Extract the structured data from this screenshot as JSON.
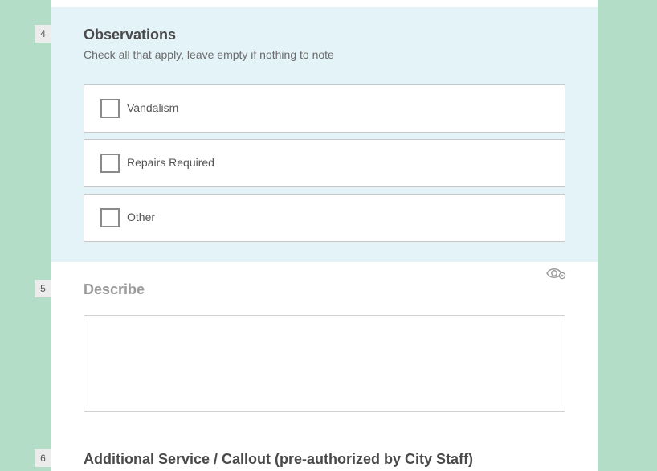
{
  "questions": [
    {
      "number": "4",
      "title": "Observations",
      "hint": "Check all that apply, leave empty if nothing to note",
      "options": [
        {
          "label": "Vandalism",
          "checked": false
        },
        {
          "label": "Repairs Required",
          "checked": false
        },
        {
          "label": "Other",
          "checked": false
        }
      ]
    },
    {
      "number": "5",
      "title": "Describe",
      "value": "",
      "icon": "visibility-rule-icon"
    },
    {
      "number": "6",
      "title": "Additional Service / Callout (pre-authorized by City Staff)"
    }
  ],
  "colors": {
    "page_background": "#b3ddc7",
    "form_background": "#ffffff",
    "highlight_background": "#e4f3f8",
    "title_text": "#4a4a4a",
    "disabled_title_text": "#9b9b9b",
    "border": "#c7c7c7"
  }
}
